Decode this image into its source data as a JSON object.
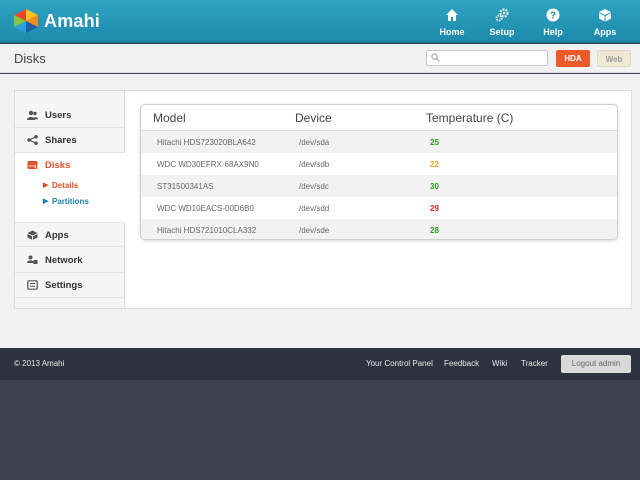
{
  "brand": {
    "name": "Amahi"
  },
  "nav": [
    {
      "label": "Home",
      "icon": "home-icon"
    },
    {
      "label": "Setup",
      "icon": "gears-icon"
    },
    {
      "label": "Help",
      "icon": "help-icon"
    },
    {
      "label": "Apps",
      "icon": "box-icon"
    }
  ],
  "subheader": {
    "title": "Disks",
    "search_value": "",
    "hda_label": "HDA",
    "web_label": "Web"
  },
  "sidebar": {
    "items": [
      {
        "label": "Users",
        "icon": "users-icon"
      },
      {
        "label": "Shares",
        "icon": "share-icon"
      },
      {
        "label": "Disks",
        "icon": "disk-icon",
        "active": true
      },
      {
        "label": "Apps",
        "icon": "puzzle-icon"
      },
      {
        "label": "Network",
        "icon": "network-icon"
      },
      {
        "label": "Settings",
        "icon": "settings-icon"
      }
    ],
    "sub_items": [
      {
        "label": "Details",
        "current": true
      },
      {
        "label": "Partitions",
        "current": false
      }
    ]
  },
  "table": {
    "headers": [
      "Model",
      "Device",
      "Temperature (C)"
    ],
    "rows": [
      {
        "model": "Hitachi HDS723020BLA642",
        "device": "/dev/sda",
        "temp": "25",
        "status": "ok"
      },
      {
        "model": "WDC WD30EFRX-68AX9N0",
        "device": "/dev/sdb",
        "temp": "22",
        "status": "warm"
      },
      {
        "model": "ST31500341AS",
        "device": "/dev/sdc",
        "temp": "30",
        "status": "ok"
      },
      {
        "model": "WDC WD10EACS-00D6B0",
        "device": "/dev/sdd",
        "temp": "29",
        "status": "hot"
      },
      {
        "model": "Hitachi HDS721010CLA332",
        "device": "/dev/sde",
        "temp": "28",
        "status": "ok"
      }
    ]
  },
  "colors": {
    "accent": "#1e8aab",
    "active": "#e0522b",
    "temp_ok": "#2a9a1a",
    "temp_warm": "#f0a020",
    "temp_hot": "#e0202a"
  },
  "footer": {
    "copyright": "© 2013 Amahi",
    "links": [
      "Your Control Panel",
      "Feedback",
      "Wiki",
      "Tracker"
    ],
    "logout_label": "Logout admin"
  }
}
